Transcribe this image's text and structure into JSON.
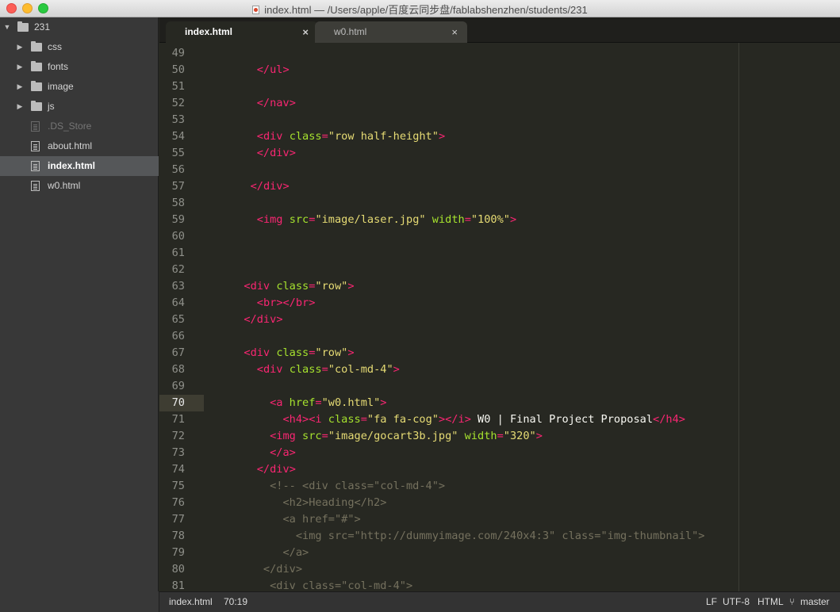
{
  "window": {
    "title": "index.html — /Users/apple/百度云同步盘/fablabshenzhen/students/231"
  },
  "sidebar": {
    "root": "231",
    "items": [
      {
        "label": "css",
        "type": "folder"
      },
      {
        "label": "fonts",
        "type": "folder"
      },
      {
        "label": "image",
        "type": "folder"
      },
      {
        "label": "js",
        "type": "folder"
      },
      {
        "label": ".DS_Store",
        "type": "file"
      },
      {
        "label": "about.html",
        "type": "file"
      },
      {
        "label": "index.html",
        "type": "file"
      },
      {
        "label": "w0.html",
        "type": "file"
      }
    ],
    "selected": "index.html"
  },
  "tabs": [
    {
      "label": "index.html",
      "close": "×",
      "active": true
    },
    {
      "label": "w0.html",
      "close": "×",
      "active": false
    }
  ],
  "editor": {
    "current_line": "70",
    "lines": [
      {
        "n": "49",
        "tokens": []
      },
      {
        "n": "50",
        "tokens": [
          [
            "t",
            "    "
          ],
          [
            "p",
            "</"
          ],
          [
            "g",
            "ul"
          ],
          [
            "p",
            ">"
          ]
        ]
      },
      {
        "n": "51",
        "tokens": []
      },
      {
        "n": "52",
        "tokens": [
          [
            "t",
            "    "
          ],
          [
            "p",
            "</"
          ],
          [
            "g",
            "nav"
          ],
          [
            "p",
            ">"
          ]
        ]
      },
      {
        "n": "53",
        "tokens": []
      },
      {
        "n": "54",
        "tokens": [
          [
            "t",
            "    "
          ],
          [
            "p",
            "<"
          ],
          [
            "g",
            "div"
          ],
          [
            "t",
            " "
          ],
          [
            "a",
            "class"
          ],
          [
            "p",
            "="
          ],
          [
            "s",
            "\"row half-height\""
          ],
          [
            "p",
            ">"
          ]
        ]
      },
      {
        "n": "55",
        "tokens": [
          [
            "t",
            "    "
          ],
          [
            "p",
            "</"
          ],
          [
            "g",
            "div"
          ],
          [
            "p",
            ">"
          ]
        ]
      },
      {
        "n": "56",
        "tokens": []
      },
      {
        "n": "57",
        "tokens": [
          [
            "t",
            "   "
          ],
          [
            "p",
            "</"
          ],
          [
            "g",
            "div"
          ],
          [
            "p",
            ">"
          ]
        ]
      },
      {
        "n": "58",
        "tokens": []
      },
      {
        "n": "59",
        "tokens": [
          [
            "t",
            "    "
          ],
          [
            "p",
            "<"
          ],
          [
            "g",
            "img"
          ],
          [
            "t",
            " "
          ],
          [
            "a",
            "src"
          ],
          [
            "p",
            "="
          ],
          [
            "s",
            "\"image/laser.jpg\""
          ],
          [
            "t",
            " "
          ],
          [
            "a",
            "width"
          ],
          [
            "p",
            "="
          ],
          [
            "s",
            "\"100%\""
          ],
          [
            "p",
            ">"
          ]
        ]
      },
      {
        "n": "60",
        "tokens": []
      },
      {
        "n": "61",
        "tokens": []
      },
      {
        "n": "62",
        "tokens": []
      },
      {
        "n": "63",
        "tokens": [
          [
            "t",
            "  "
          ],
          [
            "p",
            "<"
          ],
          [
            "g",
            "div"
          ],
          [
            "t",
            " "
          ],
          [
            "a",
            "class"
          ],
          [
            "p",
            "="
          ],
          [
            "s",
            "\"row\""
          ],
          [
            "p",
            ">"
          ]
        ]
      },
      {
        "n": "64",
        "tokens": [
          [
            "t",
            "    "
          ],
          [
            "p",
            "<"
          ],
          [
            "g",
            "br"
          ],
          [
            "p",
            "></"
          ],
          [
            "g",
            "br"
          ],
          [
            "p",
            ">"
          ]
        ]
      },
      {
        "n": "65",
        "tokens": [
          [
            "t",
            "  "
          ],
          [
            "p",
            "</"
          ],
          [
            "g",
            "div"
          ],
          [
            "p",
            ">"
          ]
        ]
      },
      {
        "n": "66",
        "tokens": []
      },
      {
        "n": "67",
        "tokens": [
          [
            "t",
            "  "
          ],
          [
            "p",
            "<"
          ],
          [
            "g",
            "div"
          ],
          [
            "t",
            " "
          ],
          [
            "a",
            "class"
          ],
          [
            "p",
            "="
          ],
          [
            "s",
            "\"row\""
          ],
          [
            "p",
            ">"
          ]
        ]
      },
      {
        "n": "68",
        "tokens": [
          [
            "t",
            "    "
          ],
          [
            "p",
            "<"
          ],
          [
            "g",
            "div"
          ],
          [
            "t",
            " "
          ],
          [
            "a",
            "class"
          ],
          [
            "p",
            "="
          ],
          [
            "s",
            "\"col-md-4\""
          ],
          [
            "p",
            ">"
          ]
        ]
      },
      {
        "n": "69",
        "tokens": []
      },
      {
        "n": "70",
        "tokens": [
          [
            "t",
            "      "
          ],
          [
            "p",
            "<"
          ],
          [
            "g",
            "a"
          ],
          [
            "t",
            " "
          ],
          [
            "a",
            "href"
          ],
          [
            "p",
            "="
          ],
          [
            "s",
            "\"w0.html\""
          ],
          [
            "p",
            ">"
          ]
        ]
      },
      {
        "n": "71",
        "tokens": [
          [
            "t",
            "        "
          ],
          [
            "p",
            "<"
          ],
          [
            "g",
            "h4"
          ],
          [
            "p",
            "><"
          ],
          [
            "g",
            "i"
          ],
          [
            "t",
            " "
          ],
          [
            "a",
            "class"
          ],
          [
            "p",
            "="
          ],
          [
            "s",
            "\"fa fa-cog\""
          ],
          [
            "p",
            "></"
          ],
          [
            "g",
            "i"
          ],
          [
            "p",
            ">"
          ],
          [
            "t",
            " W0 | Final Project Proposal"
          ],
          [
            "p",
            "</"
          ],
          [
            "g",
            "h4"
          ],
          [
            "p",
            ">"
          ]
        ]
      },
      {
        "n": "72",
        "tokens": [
          [
            "t",
            "      "
          ],
          [
            "p",
            "<"
          ],
          [
            "g",
            "img"
          ],
          [
            "t",
            " "
          ],
          [
            "a",
            "src"
          ],
          [
            "p",
            "="
          ],
          [
            "s",
            "\"image/gocart3b.jpg\""
          ],
          [
            "t",
            " "
          ],
          [
            "a",
            "width"
          ],
          [
            "p",
            "="
          ],
          [
            "s",
            "\"320\""
          ],
          [
            "p",
            ">"
          ]
        ]
      },
      {
        "n": "73",
        "tokens": [
          [
            "t",
            "      "
          ],
          [
            "p",
            "</"
          ],
          [
            "g",
            "a"
          ],
          [
            "p",
            ">"
          ]
        ]
      },
      {
        "n": "74",
        "tokens": [
          [
            "t",
            "    "
          ],
          [
            "p",
            "</"
          ],
          [
            "g",
            "div"
          ],
          [
            "p",
            ">"
          ]
        ]
      },
      {
        "n": "75",
        "tokens": [
          [
            "c",
            "      <!-- <div class=\"col-md-4\">"
          ]
        ]
      },
      {
        "n": "76",
        "tokens": [
          [
            "c",
            "        <h2>Heading</h2>"
          ]
        ]
      },
      {
        "n": "77",
        "tokens": [
          [
            "c",
            "        <a href=\"#\">"
          ]
        ]
      },
      {
        "n": "78",
        "tokens": [
          [
            "c",
            "          <img src=\"http://dummyimage.com/240x4:3\" class=\"img-thumbnail\">"
          ]
        ]
      },
      {
        "n": "79",
        "tokens": [
          [
            "c",
            "        </a>"
          ]
        ]
      },
      {
        "n": "80",
        "tokens": [
          [
            "c",
            "     </div>"
          ]
        ]
      },
      {
        "n": "81",
        "tokens": [
          [
            "c",
            "      <div class=\"col-md-4\">"
          ]
        ]
      }
    ]
  },
  "statusbar": {
    "file": "index.html",
    "position": "70:19",
    "line_ending": "LF",
    "encoding": "UTF-8",
    "syntax": "HTML",
    "branch_icon": "git-branch-icon",
    "branch": "master"
  },
  "colors": {
    "background": "#272822",
    "tag": "#f92672",
    "attribute": "#a6e22e",
    "string": "#e6db74",
    "comment": "#75715e",
    "text": "#f8f8f2"
  }
}
